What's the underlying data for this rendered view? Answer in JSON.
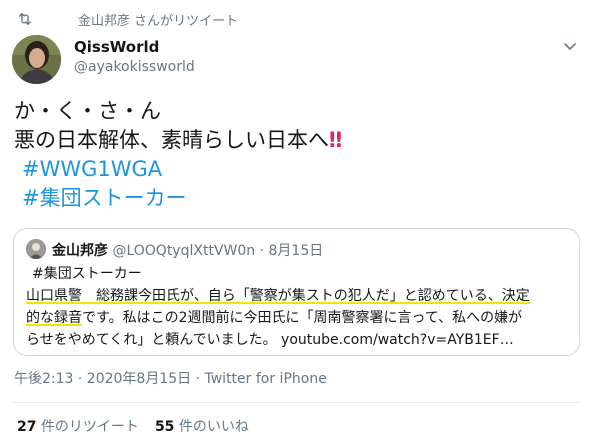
{
  "retweet": {
    "label": "金山邦彦 さんがリツイート",
    "icon": "retweet-icon"
  },
  "author": {
    "name": "QissWorld",
    "handle": "@ayakokissworld"
  },
  "tweet": {
    "line1": "か・く・さ・ん",
    "line2": "悪の日本解体、素晴らしい日本へ",
    "bang": "‼",
    "hashtag1": "#WWG1WGA",
    "hashtag2": "#集団ストーカー"
  },
  "quoted": {
    "name": "金山邦彦",
    "handle": "@LOOQtyqlXttVW0n",
    "separator": "·",
    "date": "8月15日",
    "line1": "#集団ストーカー",
    "line2": "山口県警　総務課今田氏が、自ら「警察が集ストの犯人だ」と認めている、決定",
    "line3a": "的な録音",
    "line3b": "です。私はこの2週間前に今田氏に「周南警察署に言って、私への嫌が",
    "line4": "らせをやめてくれ」と頼んでいました。 youtube.com/watch?v=AYB1EF…"
  },
  "meta": "午後2:13 · 2020年8月15日 · Twitter for iPhone",
  "stats": {
    "retweets_count": "27",
    "retweets_label": "件のリツイート",
    "likes_count": "55",
    "likes_label": "件のいいね"
  },
  "colors": {
    "link": "#1b95e0",
    "secondary": "#657786",
    "highlight": "#f2e500",
    "border": "#ccd6dd"
  }
}
